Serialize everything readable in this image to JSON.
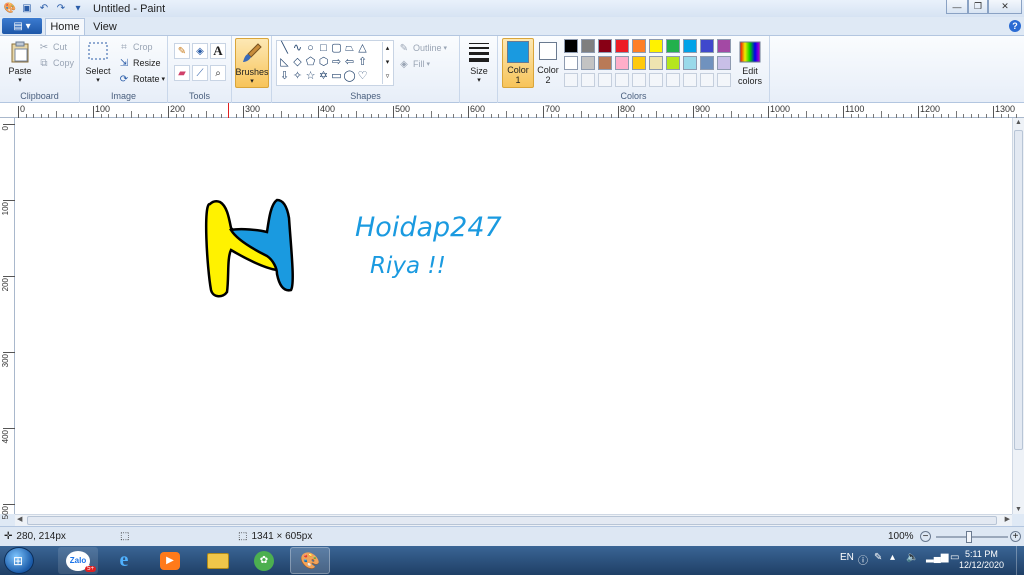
{
  "window": {
    "title": "Untitled - Paint"
  },
  "tabs": {
    "home": "Home",
    "view": "View"
  },
  "clipboard": {
    "paste": "Paste",
    "cut": "Cut",
    "copy": "Copy",
    "group_label": "Clipboard"
  },
  "image": {
    "select": "Select",
    "crop": "Crop",
    "resize": "Resize",
    "rotate": "Rotate",
    "group_label": "Image"
  },
  "tools": {
    "group_label": "Tools"
  },
  "brushes": {
    "label": "Brushes"
  },
  "shapes": {
    "outline": "Outline",
    "fill": "Fill",
    "group_label": "Shapes"
  },
  "size": {
    "label": "Size"
  },
  "colors": {
    "color1_label": "Color",
    "color1_num": "1",
    "color2_label": "Color",
    "color2_num": "2",
    "edit_label": "Edit",
    "edit_label2": "colors",
    "group_label": "Colors",
    "color1": "#1a9ae0",
    "color2": "#ffffff",
    "row1": [
      "#000000",
      "#7f7f7f",
      "#880015",
      "#ed1c24",
      "#ff7f27",
      "#fff200",
      "#22b14c",
      "#00a2e8",
      "#3f48cc",
      "#a349a4"
    ],
    "row2": [
      "#ffffff",
      "#c3c3c3",
      "#b97a57",
      "#ffaec9",
      "#ffc90e",
      "#efe4b0",
      "#b5e61d",
      "#99d9ea",
      "#7092be",
      "#c8bfe7"
    ]
  },
  "ruler": {
    "top": [
      "0",
      "100",
      "200",
      "300",
      "400",
      "500",
      "600",
      "700",
      "800",
      "900",
      "1000",
      "1100",
      "1200",
      "1300"
    ],
    "left": [
      "0",
      "100",
      "200",
      "300",
      "400",
      "500"
    ]
  },
  "drawing": {
    "text_line1": "Hoidap247",
    "text_line2": "Riya !!",
    "letter_yellow": "#fff200",
    "letter_blue": "#1a9ae0"
  },
  "status": {
    "cursor": "280, 214px",
    "image_size": "1341 × 605px",
    "zoom": "100%"
  },
  "taskbar": {
    "zalo": "Zalo",
    "zalo_badge": "5+",
    "lang": "EN",
    "time": "5:11 PM",
    "date": "12/12/2020"
  }
}
